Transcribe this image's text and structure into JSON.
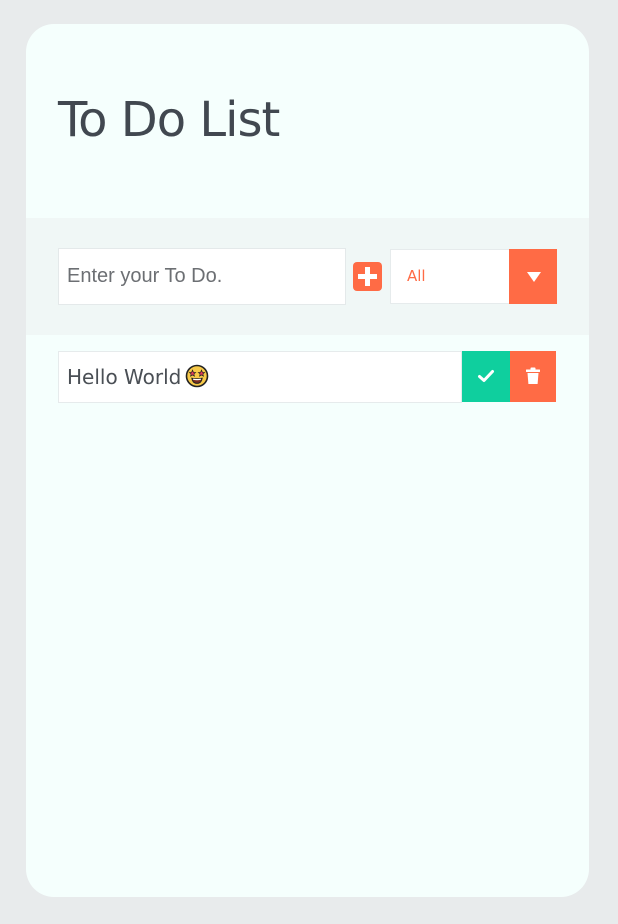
{
  "app": {
    "title": "To Do List"
  },
  "input": {
    "placeholder": "Enter your To Do.",
    "value": ""
  },
  "filter": {
    "selected": "All"
  },
  "todos": [
    {
      "text": "Hello World",
      "emoji": "star-struck-emoji"
    }
  ],
  "colors": {
    "page_background": "#e8ebec",
    "card_background": "#f5fffd",
    "band_background": "#f0f7f6",
    "accent": "#ff6b45",
    "complete": "#0fcf9e",
    "title_text": "#414850"
  },
  "icons": {
    "add": "plus-icon",
    "filter_toggle": "caret-down-icon",
    "complete": "check-icon",
    "delete": "trash-icon"
  }
}
